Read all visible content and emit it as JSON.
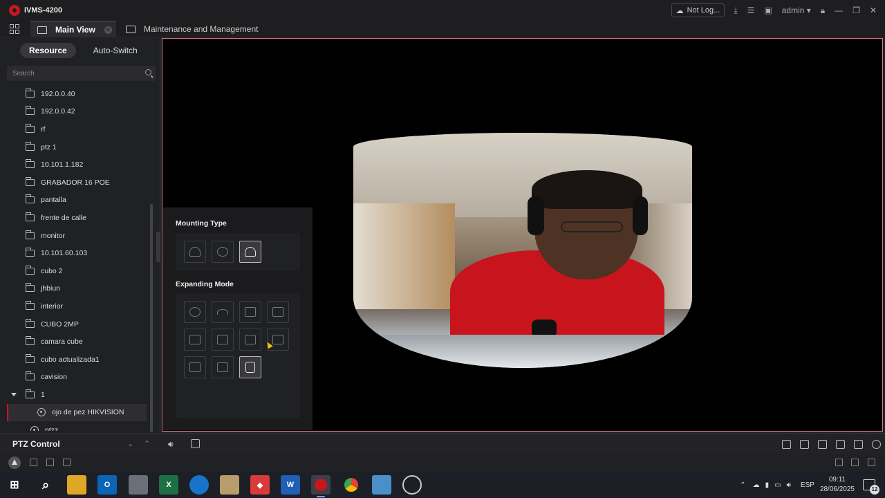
{
  "app": {
    "title": "iVMS-4200",
    "brand_color": "#c8161d"
  },
  "titlebar": {
    "cloud_status": "Not Log...",
    "user": "admin"
  },
  "tabs": [
    {
      "label": "Main View",
      "active": true
    },
    {
      "label": "Maintenance and Management",
      "active": false
    }
  ],
  "sidebar": {
    "tab_resource": "Resource",
    "tab_autoswitch": "Auto-Switch",
    "search_placeholder": "Search",
    "items": [
      {
        "label": "192.0.0.40"
      },
      {
        "label": "192.0.0.42"
      },
      {
        "label": "rf"
      },
      {
        "label": "ptz 1"
      },
      {
        "label": "10.101.1.182"
      },
      {
        "label": "GRABADOR 16 POE"
      },
      {
        "label": "pantalla"
      },
      {
        "label": "frente de calle"
      },
      {
        "label": "monitor"
      },
      {
        "label": "10.101.60.103"
      },
      {
        "label": "cubo 2"
      },
      {
        "label": "jhbiun"
      },
      {
        "label": "interior"
      },
      {
        "label": "CUBO 2MP"
      },
      {
        "label": "camara cube"
      },
      {
        "label": "cubo actualizada1"
      },
      {
        "label": "cavision"
      },
      {
        "label": "1",
        "expanded": true
      },
      {
        "label": "ojo de pez HIKVISION",
        "selected": true,
        "type": "camera"
      },
      {
        "label": "ptzz"
      }
    ]
  },
  "mounting_panel": {
    "mounting_type_label": "Mounting Type",
    "mounting_options": [
      "wall-mount-icon",
      "ceiling-mount-icon",
      "desktop-mount-icon"
    ],
    "mounting_selected": 2,
    "expanding_mode_label": "Expanding Mode",
    "expanding_options": [
      "fisheye-icon",
      "panorama-180-icon",
      "panorama-360-icon",
      "ptz-expand-icon",
      "1p-3ptz-icon",
      "2p-ptz-icon",
      "4ptz-icon",
      "split-4-icon",
      "1p-6ptz-icon",
      "1p-8ptz-icon",
      "cylinder-icon"
    ],
    "expanding_selected": 10
  },
  "ptz": {
    "label": "PTZ Control"
  },
  "taskbar": {
    "language": "ESP",
    "time": "09:11",
    "date": "28/06/2025",
    "notifications": "12"
  }
}
